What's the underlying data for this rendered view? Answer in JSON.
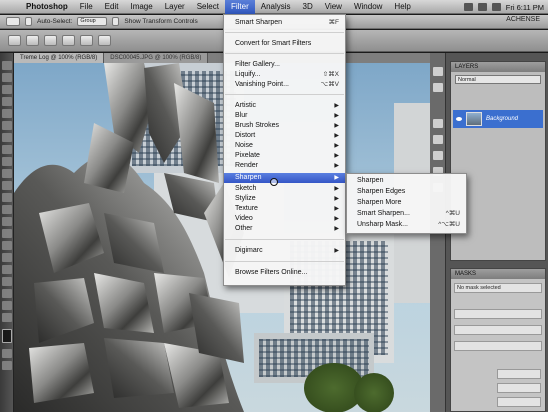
{
  "menubar": {
    "app": "Photoshop",
    "items": [
      "File",
      "Edit",
      "Image",
      "Layer",
      "Select",
      "Filter",
      "Analysis",
      "3D",
      "View",
      "Window",
      "Help"
    ],
    "active": "Filter",
    "clock": "Fri 6:11 PM"
  },
  "options_bar": {
    "auto_select": "Auto-Select:",
    "auto_select_value": "Group",
    "show_transform": "Show Transform Controls",
    "workspace": "ACHENSE"
  },
  "tabs": [
    {
      "label": "Treme Log @ 100% (RGB/8)"
    },
    {
      "label": "DSC00045.JPG @ 100% (RGB/8)"
    }
  ],
  "filter_menu": {
    "items": [
      {
        "label": "Smart Sharpen",
        "shortcut": "⌘F"
      },
      {
        "label": "Convert for Smart Filters",
        "shortcut": ""
      },
      {
        "label": "Filter Gallery...",
        "shortcut": ""
      },
      {
        "label": "Liquify...",
        "shortcut": "⇧⌘X"
      },
      {
        "label": "Vanishing Point...",
        "shortcut": "⌥⌘V"
      },
      {
        "label": "Artistic",
        "submenu": true
      },
      {
        "label": "Blur",
        "submenu": true
      },
      {
        "label": "Brush Strokes",
        "submenu": true
      },
      {
        "label": "Distort",
        "submenu": true
      },
      {
        "label": "Noise",
        "submenu": true
      },
      {
        "label": "Pixelate",
        "submenu": true
      },
      {
        "label": "Render",
        "submenu": true
      },
      {
        "label": "Sharpen",
        "submenu": true,
        "highlighted": true
      },
      {
        "label": "Sketch",
        "submenu": true
      },
      {
        "label": "Stylize",
        "submenu": true
      },
      {
        "label": "Texture",
        "submenu": true
      },
      {
        "label": "Video",
        "submenu": true
      },
      {
        "label": "Other",
        "submenu": true
      },
      {
        "label": "Digimarc",
        "submenu": true
      },
      {
        "label": "Browse Filters Online...",
        "shortcut": ""
      }
    ]
  },
  "sharpen_submenu": {
    "items": [
      {
        "label": "Sharpen",
        "shortcut": ""
      },
      {
        "label": "Sharpen Edges",
        "shortcut": ""
      },
      {
        "label": "Sharpen More",
        "shortcut": ""
      },
      {
        "label": "Smart Sharpen...",
        "shortcut": "^⌘U"
      },
      {
        "label": "Unsharp Mask...",
        "shortcut": "^⌥⌘U"
      }
    ]
  },
  "layers_panel": {
    "title": "LAYERS",
    "blend_mode": "Normal",
    "layer_name": "Background"
  },
  "actions_panel": {
    "title": "MASKS",
    "no_mask": "No mask selected"
  },
  "colors": {
    "menu_highlight": "#3b62d0",
    "layer_selected": "#3b6fcf"
  }
}
